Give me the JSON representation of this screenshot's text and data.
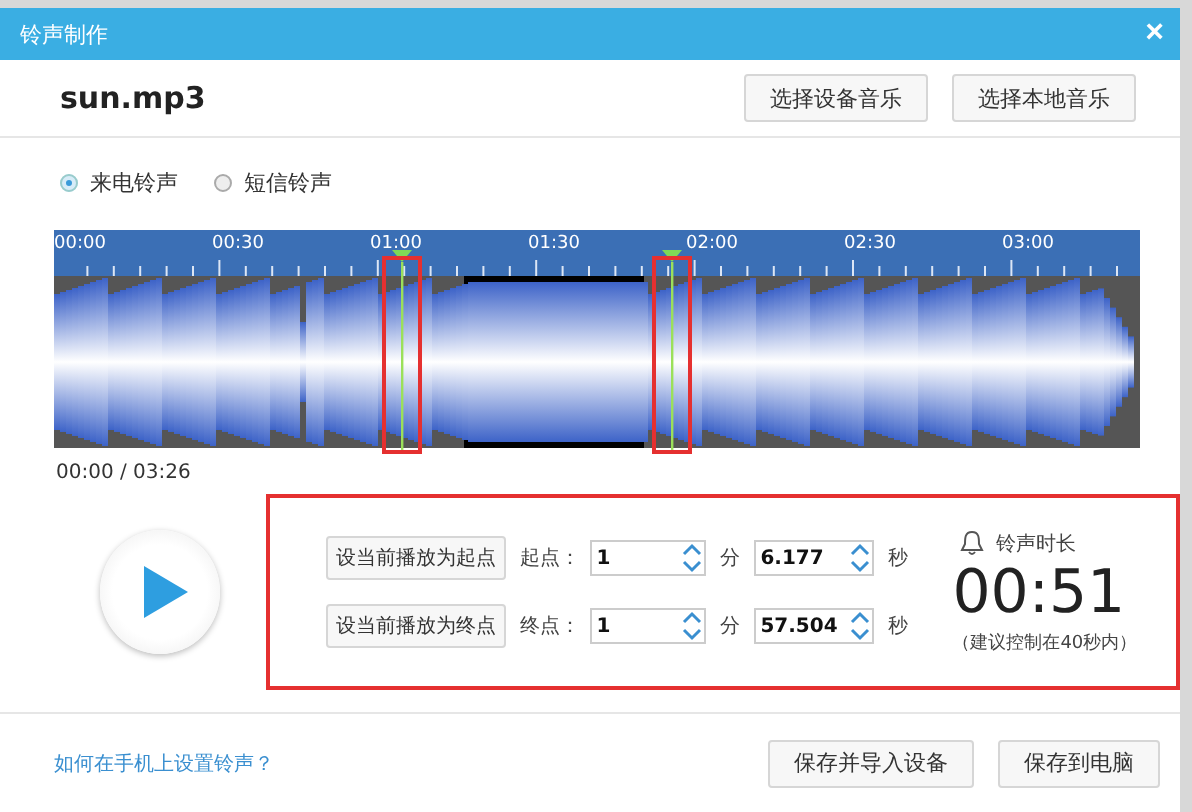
{
  "window": {
    "title": "铃声制作",
    "close": "×"
  },
  "file": {
    "name": "sun.mp3"
  },
  "header_buttons": [
    "选择设备音乐",
    "选择本地音乐"
  ],
  "ringtone_types": [
    {
      "label": "来电铃声",
      "selected": true
    },
    {
      "label": "短信铃声",
      "selected": false
    }
  ],
  "waveform": {
    "ruler": [
      "00:00",
      "00:30",
      "01:00",
      "01:30",
      "02:00",
      "02:30",
      "03:00"
    ],
    "markers": [
      {
        "level": 0.321
      },
      {
        "level": 0.569
      }
    ],
    "time": "00:00 / 03:26"
  },
  "points": [
    {
      "button": "设当前播放为起点",
      "label": "起点：",
      "minutes": "1",
      "min_unit": "分",
      "seconds": "6.177",
      "sec_unit": "秒"
    },
    {
      "button": "设当前播放为终点",
      "label": "终点：",
      "minutes": "1",
      "min_unit": "分",
      "seconds": "57.504",
      "sec_unit": "秒"
    }
  ],
  "duration": {
    "label": "铃声时长",
    "value": "00:51",
    "hint": "（建议控制在40秒内）"
  },
  "footer": {
    "link": "如何在手机上设置铃声？",
    "buttons": [
      "保存并导入设备",
      "保存到电脑"
    ]
  }
}
